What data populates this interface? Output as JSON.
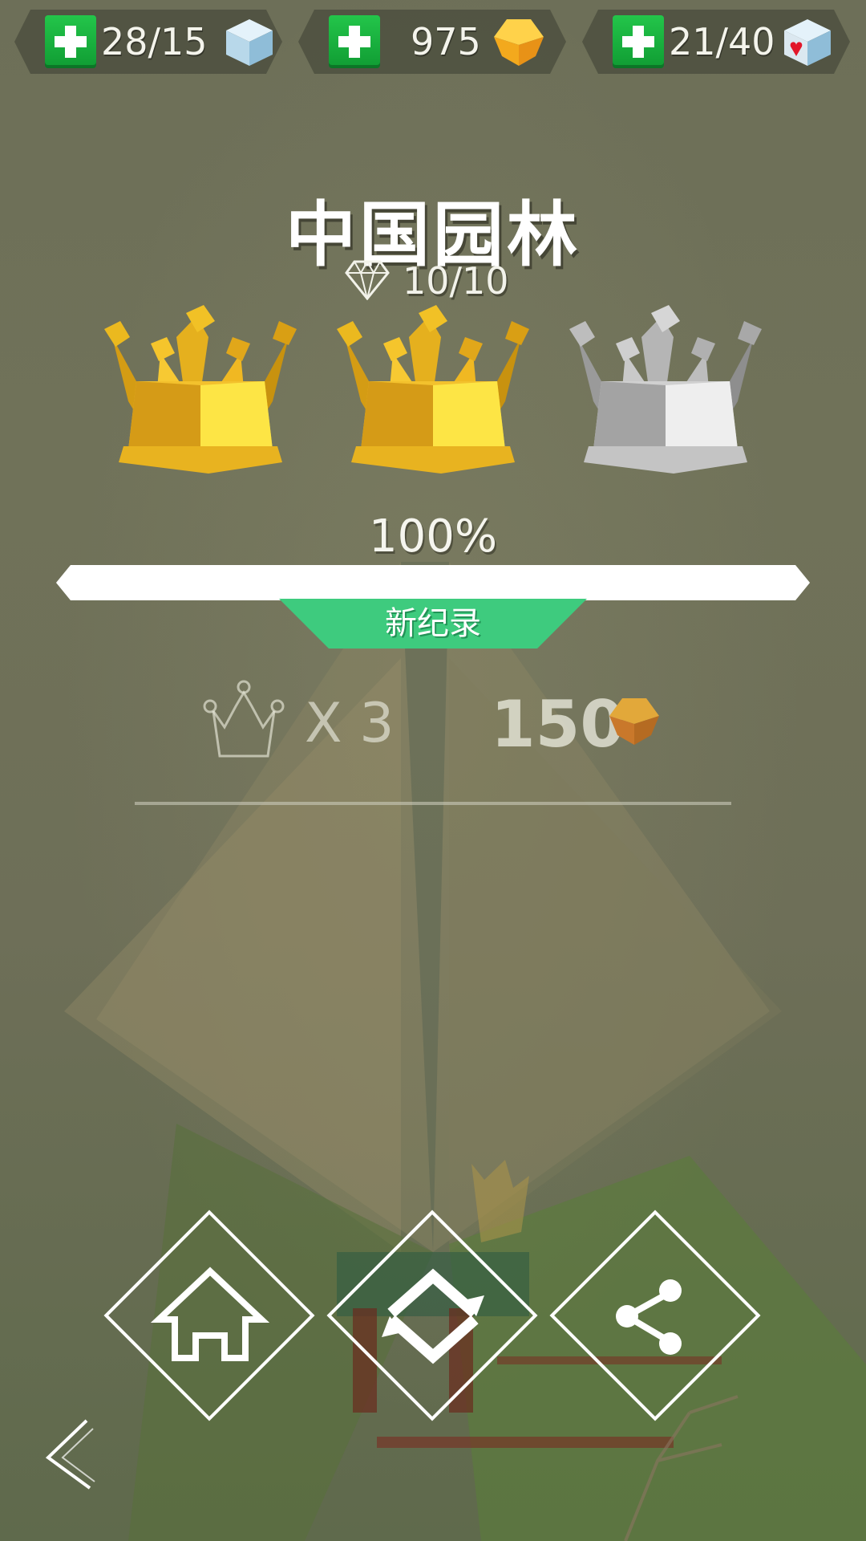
{
  "resources": {
    "cubes": {
      "value": "28/15",
      "icon": "ice-cube-icon"
    },
    "gems": {
      "value": "975",
      "icon": "gold-gem-icon"
    },
    "lives": {
      "value": "21/40",
      "icon": "heart-cube-icon"
    }
  },
  "level": {
    "title": "中国园林",
    "diamonds": "10/10",
    "crowns": [
      {
        "state": "gold",
        "color": "#f2c41a"
      },
      {
        "state": "gold",
        "color": "#f2c41a"
      },
      {
        "state": "silver",
        "color": "#cfcfcf"
      }
    ],
    "percent_text": "100%",
    "progress_value": 1.0,
    "record_label": "新纪录",
    "crown_multiplier": "X 3",
    "reward_value": "150"
  },
  "buttons": {
    "home": "home-icon",
    "replay": "replay-icon",
    "share": "share-icon",
    "back": "back-arrow-icon"
  },
  "colors": {
    "accent_green": "#3ecb7e",
    "plus_green": "#1cb842",
    "gold": "#f2c41a"
  }
}
